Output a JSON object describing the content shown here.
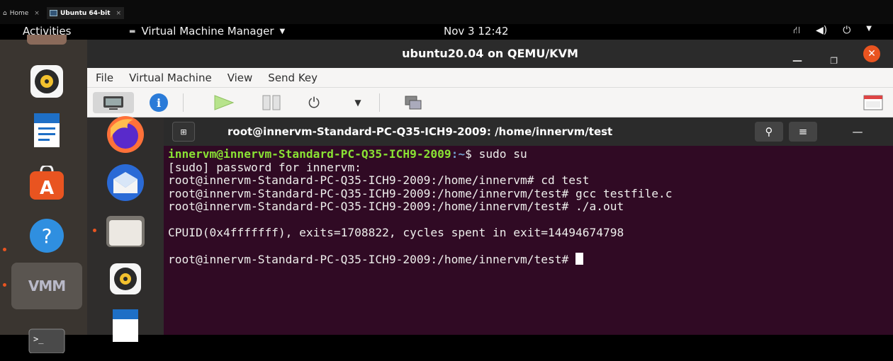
{
  "host_tabs": [
    {
      "label": "Home",
      "close": "×"
    },
    {
      "label": "Ubuntu 64-bit",
      "close": "×"
    }
  ],
  "topbar": {
    "activities": "Activities",
    "app_menu": "Virtual Machine Manager",
    "clock": "Nov 3  12:42"
  },
  "vm_window": {
    "title": "ubuntu20.04 on QEMU/KVM",
    "menu": [
      "File",
      "Virtual Machine",
      "View",
      "Send Key"
    ]
  },
  "terminal": {
    "title": "root@innervm-Standard-PC-Q35-ICH9-2009: /home/innervm/test",
    "prompt_user": "innervm@innervm-Standard-PC-Q35-ICH9-2009",
    "prompt_path": ":~",
    "prompt_cmd": "$ sudo su",
    "lines": [
      "[sudo] password for innervm:",
      "root@innervm-Standard-PC-Q35-ICH9-2009:/home/innervm# cd test",
      "root@innervm-Standard-PC-Q35-ICH9-2009:/home/innervm/test# gcc testfile.c",
      "root@innervm-Standard-PC-Q35-ICH9-2009:/home/innervm/test# ./a.out"
    ],
    "output": "CPUID(0x4fffffff), exits=1708822, cycles spent in exit=14494674798",
    "final_prompt": "root@innervm-Standard-PC-Q35-ICH9-2009:/home/innervm/test# "
  },
  "colors": {
    "terminal_bg": "#300a24",
    "ubuntu_orange": "#e95420",
    "prompt_green": "#8ae234",
    "prompt_blue": "#729fcf"
  }
}
